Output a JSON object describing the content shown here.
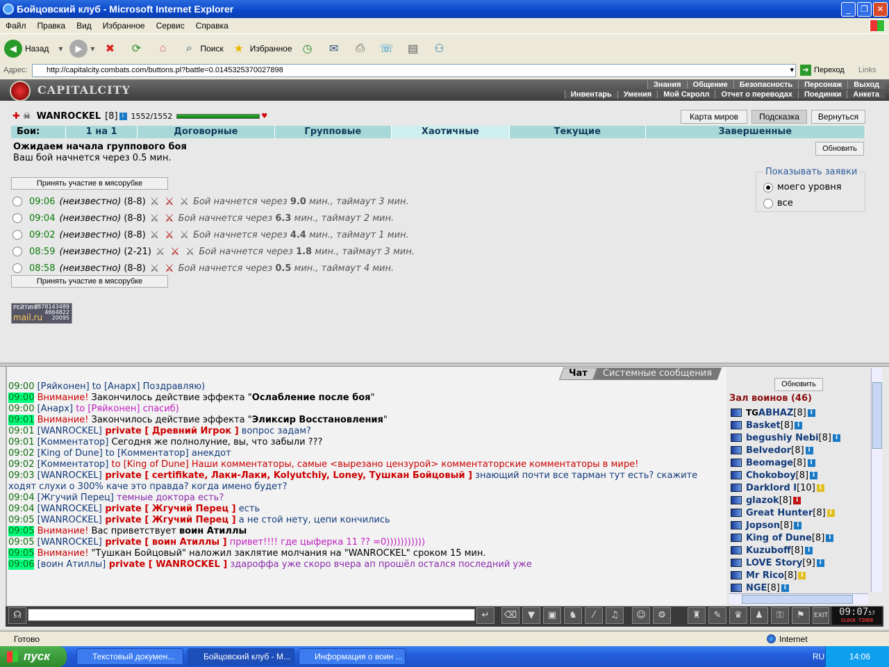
{
  "window": {
    "title": "Бойцовский клуб - Microsoft Internet Explorer"
  },
  "menu": [
    "Файл",
    "Правка",
    "Вид",
    "Избранное",
    "Сервис",
    "Справка"
  ],
  "toolbar": {
    "back": "Назад",
    "search": "Поиск",
    "favorites": "Избранное"
  },
  "address": {
    "label": "Адрес:",
    "url": "http://capitalcity.combats.com/buttons.pl?battle=0.0145325370027898",
    "go": "Переход",
    "links": "Links"
  },
  "game": {
    "logo": "CAPITALCITY",
    "nav_top": [
      "Знания",
      "Общение",
      "Безопасность",
      "Персонаж",
      "Выход"
    ],
    "nav_bottom": [
      "Инвентарь",
      "Умения",
      "Мой Скролл",
      "Отчет о переводах",
      "Поединки",
      "Анкета"
    ],
    "hero": {
      "name": "WANROCKEL",
      "level": "[8]",
      "hp": "1552/1552",
      "hp_fraction": 1.0
    },
    "buttons": {
      "world_map": "Карта миров",
      "hint": "Подсказка",
      "back": "Вернуться",
      "refresh": "Обновить"
    },
    "tabs": [
      "Бои:",
      "1 на 1",
      "Договорные",
      "Групповые",
      "Хаотичные",
      "Текущие",
      "Завершенные"
    ],
    "active_tab": "Хаотичные",
    "wait_title": "Ожидаем начала группового боя",
    "wait_sub": "Ваш бой начнется через 0.5 мин.",
    "show_requests": {
      "title": "Показывать заявки",
      "opt1": "моего уровня",
      "opt2": "все"
    },
    "join_label": "Принять участие в мясорубке",
    "battles": [
      {
        "time": "09:06",
        "who": "(неизвестно)",
        "range": "(8-8)",
        "pre": "Бой начнется через ",
        "mins": "9.0",
        "post": " мин., таймаут 3 мин."
      },
      {
        "time": "09:04",
        "who": "(неизвестно)",
        "range": "(8-8)",
        "pre": "Бой начнется через ",
        "mins": "6.3",
        "post": " мин., таймаут 2 мин."
      },
      {
        "time": "09:02",
        "who": "(неизвестно)",
        "range": "(8-8)",
        "pre": "Бой начнется через ",
        "mins": "4.4",
        "post": " мин., таймаут 1 мин."
      },
      {
        "time": "08:59",
        "who": "(неизвестно)",
        "range": "(2-21)",
        "pre": "Бой начнется через ",
        "mins": "1.8",
        "post": " мин., таймаут 3 мин."
      },
      {
        "time": "08:58",
        "who": "(неизвестно)",
        "range": "(8-8)",
        "pre": "Бой начнется через ",
        "mins": "0.5",
        "post": " мин., таймаут 4 мин."
      }
    ],
    "rating": {
      "title": "РЕЙТИНГ",
      "n1": "3878143489",
      "n2": "4664822",
      "n3": "20095",
      "brand": "mail.ru"
    }
  },
  "chat": {
    "tabs": [
      "Чат",
      "Системные сообщения"
    ],
    "lines": [
      {
        "t": "09:00",
        "hl": false,
        "parts": [
          [
            "n",
            "[Ряйконен]"
          ],
          [
            "b",
            " to [Анарх] Поздравляю)"
          ]
        ]
      },
      {
        "t": "09:00",
        "hl": true,
        "parts": [
          [
            "w",
            "Внимание!"
          ],
          [
            "k",
            " Закончилось действие эффекта \""
          ],
          [
            "x",
            "Ослабление после боя"
          ],
          [
            "k",
            "\""
          ]
        ]
      },
      {
        "t": "09:00",
        "hl": false,
        "parts": [
          [
            "n",
            "[Анарх]"
          ],
          [
            "p",
            " to [Ряйконен] спасиб)"
          ]
        ]
      },
      {
        "t": "09:01",
        "hl": true,
        "parts": [
          [
            "w",
            "Внимание!"
          ],
          [
            "k",
            " Закончилось действие эффекта \""
          ],
          [
            "x",
            "Эликсир Восстановления"
          ],
          [
            "k",
            "\""
          ]
        ]
      },
      {
        "t": "09:01",
        "hl": false,
        "parts": [
          [
            "n",
            "[WANROCKEL]"
          ],
          [
            "pv",
            " private [ Древний Игрок ]"
          ],
          [
            "n",
            " вопрос задам?"
          ]
        ]
      },
      {
        "t": "09:01",
        "hl": false,
        "parts": [
          [
            "n",
            "[Комментатор]"
          ],
          [
            "k",
            " Сегодня же полнолуние, вы, что забыли ???"
          ]
        ]
      },
      {
        "t": "09:02",
        "hl": false,
        "parts": [
          [
            "n",
            "[King of Dune]"
          ],
          [
            "n",
            " to [Комментатор] анекдот"
          ]
        ]
      },
      {
        "t": "09:02",
        "hl": false,
        "parts": [
          [
            "n",
            "[Комментатор]"
          ],
          [
            "w",
            " to [King of Dune] Наши комментаторы, самые <вырезано цензурой> комментаторские комментаторы в мире!"
          ]
        ]
      },
      {
        "t": "09:03",
        "hl": false,
        "parts": [
          [
            "n",
            "[WANROCKEL]"
          ],
          [
            "pv",
            " private [ certifikate, Лаки-Лаки, Kolyutchiy, Loney, Тушкан Бойцовый ]"
          ],
          [
            "n",
            " знающий почти все тарман тут есть? скажите"
          ]
        ]
      },
      {
        "t": "",
        "hl": false,
        "parts": [
          [
            "n",
            "ходят слухи о 300% каче это правда? когда имено будет?"
          ]
        ]
      },
      {
        "t": "09:04",
        "hl": false,
        "parts": [
          [
            "n",
            "[Жгучий Перец]"
          ],
          [
            "pt",
            " темные доктора есть?"
          ]
        ]
      },
      {
        "t": "09:04",
        "hl": false,
        "parts": [
          [
            "n",
            "[WANROCKEL]"
          ],
          [
            "pv",
            " private [ Жгучий Перец ]"
          ],
          [
            "n",
            " есть"
          ]
        ]
      },
      {
        "t": "09:05",
        "hl": false,
        "parts": [
          [
            "n",
            "[WANROCKEL]"
          ],
          [
            "pv",
            " private [ Жгучий Перец ]"
          ],
          [
            "n",
            " а не стой нету, цепи кончились"
          ]
        ]
      },
      {
        "t": "09:05",
        "hl": true,
        "parts": [
          [
            "w",
            "Внимание!"
          ],
          [
            "k",
            " Вас приветствует "
          ],
          [
            "nb",
            "воин Атиллы"
          ]
        ]
      },
      {
        "t": "09:05",
        "hl": false,
        "parts": [
          [
            "n",
            "[WANROCKEL]"
          ],
          [
            "pv",
            " private [ воин Атиллы ]"
          ],
          [
            "p",
            " привет!!!! где цыферка 11 ?? =0)))))))))))"
          ]
        ]
      },
      {
        "t": "09:05",
        "hl": true,
        "parts": [
          [
            "w",
            "Внимание!"
          ],
          [
            "k",
            " \"Тушкан Бойцовый\" наложил заклятие молчания на \"WANROCKEL\" сроком 15 мин."
          ]
        ]
      },
      {
        "t": "09:06",
        "hl": true,
        "parts": [
          [
            "n",
            "[воин Атиллы]"
          ],
          [
            "pv",
            " private [ WANROCKEL ]"
          ],
          [
            "pt",
            " здароффа уже скоро вчера ап прошёл остался последний уже"
          ]
        ]
      }
    ]
  },
  "users": {
    "refresh": "Обновить",
    "title": "Зал воинов (46)",
    "list": [
      {
        "name": "ABHAZ",
        "lvl": "[8]",
        "prefix": "TG",
        "info": "b"
      },
      {
        "name": "Basket",
        "lvl": "[8]",
        "prefix": "",
        "info": "g"
      },
      {
        "name": "begushiy Nebi",
        "lvl": "[8]",
        "prefix": "",
        "info": "b"
      },
      {
        "name": "Belvedor",
        "lvl": "[8]",
        "prefix": "",
        "info": "b"
      },
      {
        "name": "Beomage",
        "lvl": "[8]",
        "prefix": "",
        "info": "b"
      },
      {
        "name": "Chokoboy",
        "lvl": "[8]",
        "prefix": "",
        "info": "b"
      },
      {
        "name": "Darklord I",
        "lvl": "[10]",
        "prefix": "",
        "info": "y"
      },
      {
        "name": "glazok",
        "lvl": "[8]",
        "prefix": "",
        "info": "r"
      },
      {
        "name": "Great Hunter",
        "lvl": "[8]",
        "prefix": "",
        "info": "y"
      },
      {
        "name": "Jopson",
        "lvl": "[8]",
        "prefix": "",
        "info": "b"
      },
      {
        "name": "King of Dune",
        "lvl": "[8]",
        "prefix": "",
        "info": "b"
      },
      {
        "name": "Kuzuboff",
        "lvl": "[8]",
        "prefix": "",
        "info": "b"
      },
      {
        "name": "LOVE Story",
        "lvl": "[9]",
        "prefix": "",
        "info": "b"
      },
      {
        "name": "Mr Rico",
        "lvl": "[8]",
        "prefix": "",
        "info": "y"
      },
      {
        "name": "NGE",
        "lvl": "[8]",
        "prefix": "",
        "info": "b"
      }
    ]
  },
  "clock": {
    "time": "09:07",
    "sec": "57",
    "label": "CLOCK TIMER"
  },
  "status": {
    "left": "Готово",
    "zone": "Internet"
  },
  "taskbar": {
    "start": "пуск",
    "tasks": [
      "Текстовый докумен...",
      "Бойцовский клуб - М...",
      "Информация о воин ..."
    ],
    "lang": "RU",
    "time": "14:06"
  }
}
